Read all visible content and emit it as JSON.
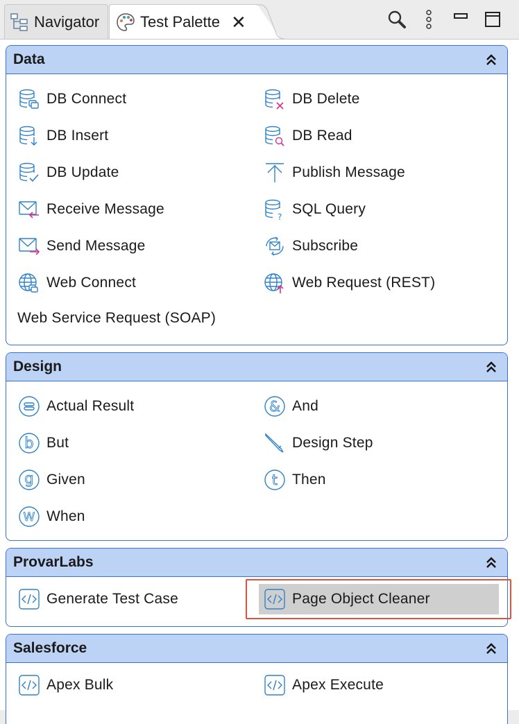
{
  "tabs": [
    {
      "label": "Navigator",
      "icon": "navigator-tree-icon"
    },
    {
      "label": "Test Palette",
      "icon": "palette-icon",
      "close": "✕"
    }
  ],
  "toolbar": {
    "icons": [
      "search-icon",
      "view-menu-icon",
      "minimize-icon",
      "maximize-icon"
    ]
  },
  "drawers": [
    {
      "title": "Data",
      "items": [
        {
          "label": "DB Connect",
          "icon": "db-connect-icon"
        },
        {
          "label": "DB Delete",
          "icon": "db-delete-icon"
        },
        {
          "label": "DB Insert",
          "icon": "db-insert-icon"
        },
        {
          "label": "DB Read",
          "icon": "db-read-icon"
        },
        {
          "label": "DB Update",
          "icon": "db-update-icon"
        },
        {
          "label": "Publish Message",
          "icon": "publish-icon"
        },
        {
          "label": "Receive Message",
          "icon": "receive-message-icon"
        },
        {
          "label": "SQL Query",
          "icon": "sql-query-icon"
        },
        {
          "label": "Send Message",
          "icon": "send-message-icon"
        },
        {
          "label": "Subscribe",
          "icon": "subscribe-icon"
        },
        {
          "label": "Web Connect",
          "icon": "web-connect-icon"
        },
        {
          "label": "Web Request (REST)",
          "icon": "web-request-icon"
        },
        {
          "label": "Web Service Request (SOAP)",
          "icon": ""
        }
      ]
    },
    {
      "title": "Design",
      "items": [
        {
          "label": "Actual Result",
          "icon": "actual-result-icon"
        },
        {
          "label": "And",
          "icon": "and-icon"
        },
        {
          "label": "But",
          "icon": "but-icon"
        },
        {
          "label": "Design Step",
          "icon": "design-step-icon"
        },
        {
          "label": "Given",
          "icon": "given-icon"
        },
        {
          "label": "Then",
          "icon": "then-icon"
        },
        {
          "label": "When",
          "icon": "when-icon"
        }
      ]
    },
    {
      "title": "ProvarLabs",
      "items": [
        {
          "label": "Generate Test Case",
          "icon": "code-icon"
        },
        {
          "label": "Page Object Cleaner",
          "icon": "code-icon",
          "selected": true
        }
      ]
    },
    {
      "title": "Salesforce",
      "items": [
        {
          "label": "Apex Bulk",
          "icon": "code-icon"
        },
        {
          "label": "Apex Execute",
          "icon": "code-icon"
        }
      ]
    }
  ],
  "colors": {
    "drawer_border": "#3b6fd9",
    "drawer_header": "#bcd3f5",
    "icon_stroke": "#2f82c9",
    "icon_accent": "#d6338f",
    "highlight": "#e0533a",
    "selected": "#cfcfcf"
  }
}
